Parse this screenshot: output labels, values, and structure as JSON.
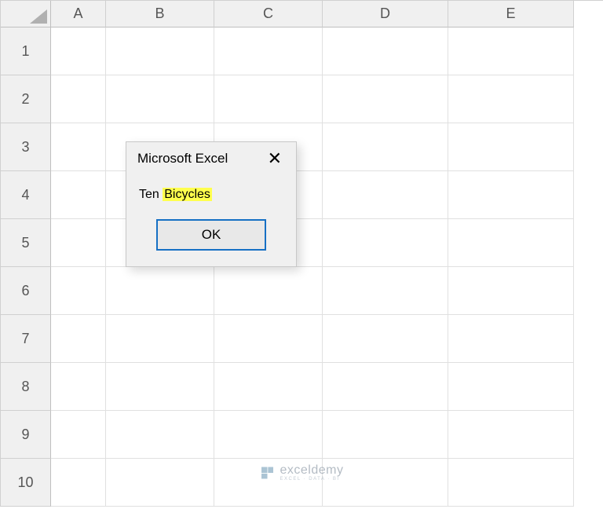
{
  "columns": [
    "A",
    "B",
    "C",
    "D",
    "E"
  ],
  "rows": [
    "1",
    "2",
    "3",
    "4",
    "5",
    "6",
    "7",
    "8",
    "9",
    "10"
  ],
  "dialog": {
    "title": "Microsoft Excel",
    "close_label": "✕",
    "message_plain": "Ten",
    "message_highlighted": "Bicycles",
    "ok_label": "OK"
  },
  "watermark": {
    "brand": "exceldemy",
    "sub": "EXCEL · DATA · BI"
  }
}
